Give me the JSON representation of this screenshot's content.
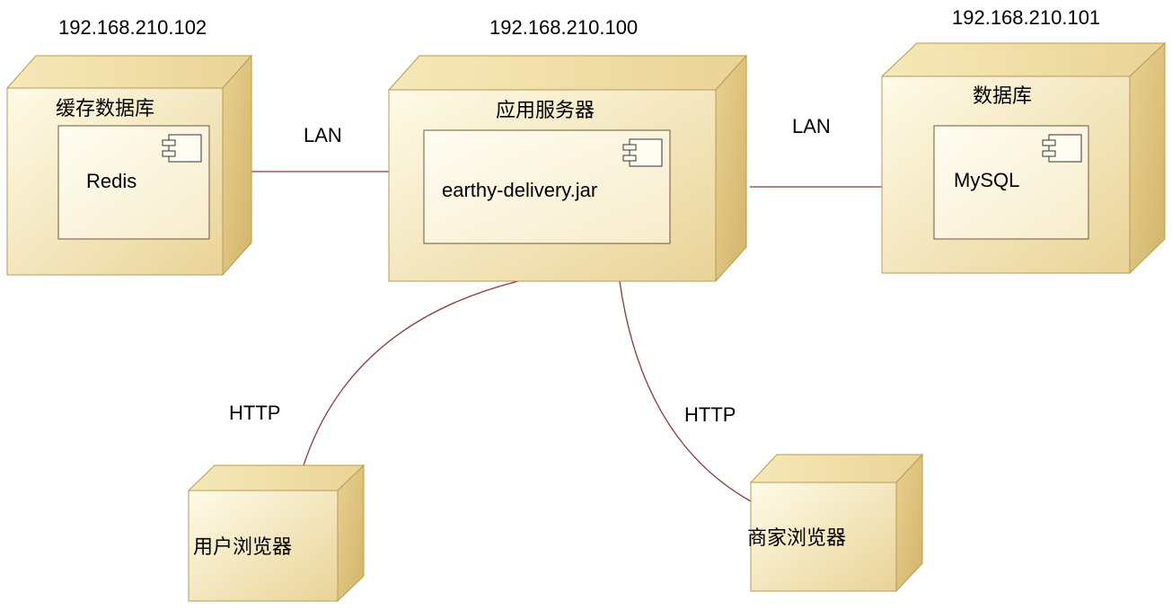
{
  "colors": {
    "box_front_light": "#fff7dc",
    "box_front_dark": "#e6cf92",
    "box_top": "#f2e2ac",
    "box_side": "#dcc080",
    "box_stroke": "#b79b52",
    "component_fill": "#fef9e6",
    "component_stroke": "#6b5a33",
    "edge": "#8b3a3a"
  },
  "nodes": {
    "redis_node": {
      "ip": "192.168.210.102",
      "title": "缓存数据库",
      "component": "Redis"
    },
    "app_node": {
      "ip": "192.168.210.100",
      "title": "应用服务器",
      "component": "earthy-delivery.jar"
    },
    "db_node": {
      "ip": "192.168.210.101",
      "title": "数据库",
      "component": "MySQL"
    },
    "user_browser": {
      "title": "用户浏览器"
    },
    "merchant_browser": {
      "title": "商家浏览器"
    }
  },
  "edges": {
    "redis_app": {
      "label": "LAN"
    },
    "app_db": {
      "label": "LAN"
    },
    "app_user": {
      "label": "HTTP"
    },
    "app_merchant": {
      "label": "HTTP"
    }
  }
}
